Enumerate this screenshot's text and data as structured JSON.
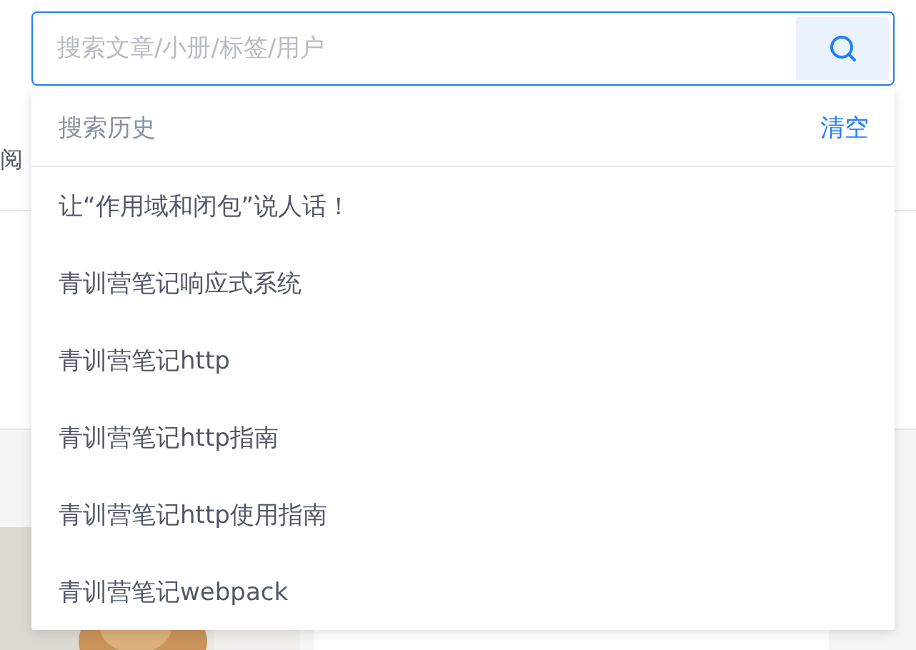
{
  "nav": {
    "tab": "阅"
  },
  "search": {
    "placeholder": "搜索文章/小册/标签/用户"
  },
  "history": {
    "title": "搜索历史",
    "clear": "清空",
    "items": [
      "让“作用域和闭包”说人话！",
      "青训营笔记响应式系统",
      "青训营笔记http",
      "青训营笔记http指南",
      "青训营笔记http使用指南",
      "青训营笔记webpack"
    ]
  }
}
